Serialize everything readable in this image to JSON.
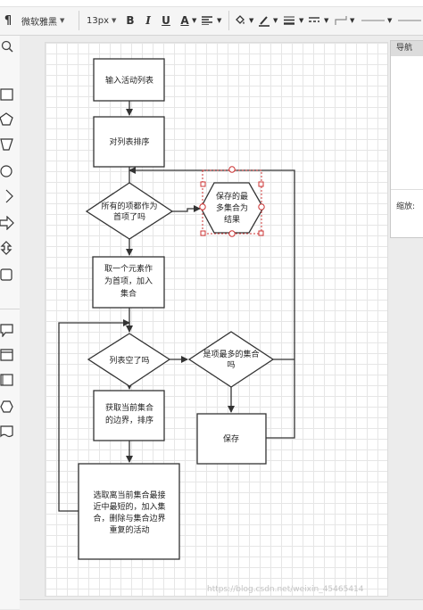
{
  "toolbar": {
    "font_family": "微软雅黑",
    "font_size": "13px",
    "bold": "B",
    "italic": "I",
    "underline": "U",
    "font_color": "A"
  },
  "navigator": {
    "title": "导航",
    "zoom_label": "缩放:"
  },
  "flowchart": {
    "nodes": {
      "input": "输入活动列表",
      "sort": "对列表排序",
      "check_all": [
        "所有的项都作为",
        "首项了吗"
      ],
      "output": [
        "保存的最",
        "多集合为",
        "结果"
      ],
      "take_one": [
        "取一个元素作",
        "为首项，加入",
        "集合"
      ],
      "list_empty": "列表空了吗",
      "get_boundary": [
        "获取当前集合",
        "的边界，排序"
      ],
      "is_max": [
        "是项最多的集合",
        "吗"
      ],
      "save": "保存",
      "select_nearest": [
        "选取离当前集合最接",
        "近中最短的，加入集",
        "合，删除与集合边界",
        "重复的活动"
      ]
    }
  },
  "watermark": "https://blog.csdn.net/weixin_45465414",
  "colors": {
    "accent_selection": "#cc3333",
    "line": "#333333"
  }
}
